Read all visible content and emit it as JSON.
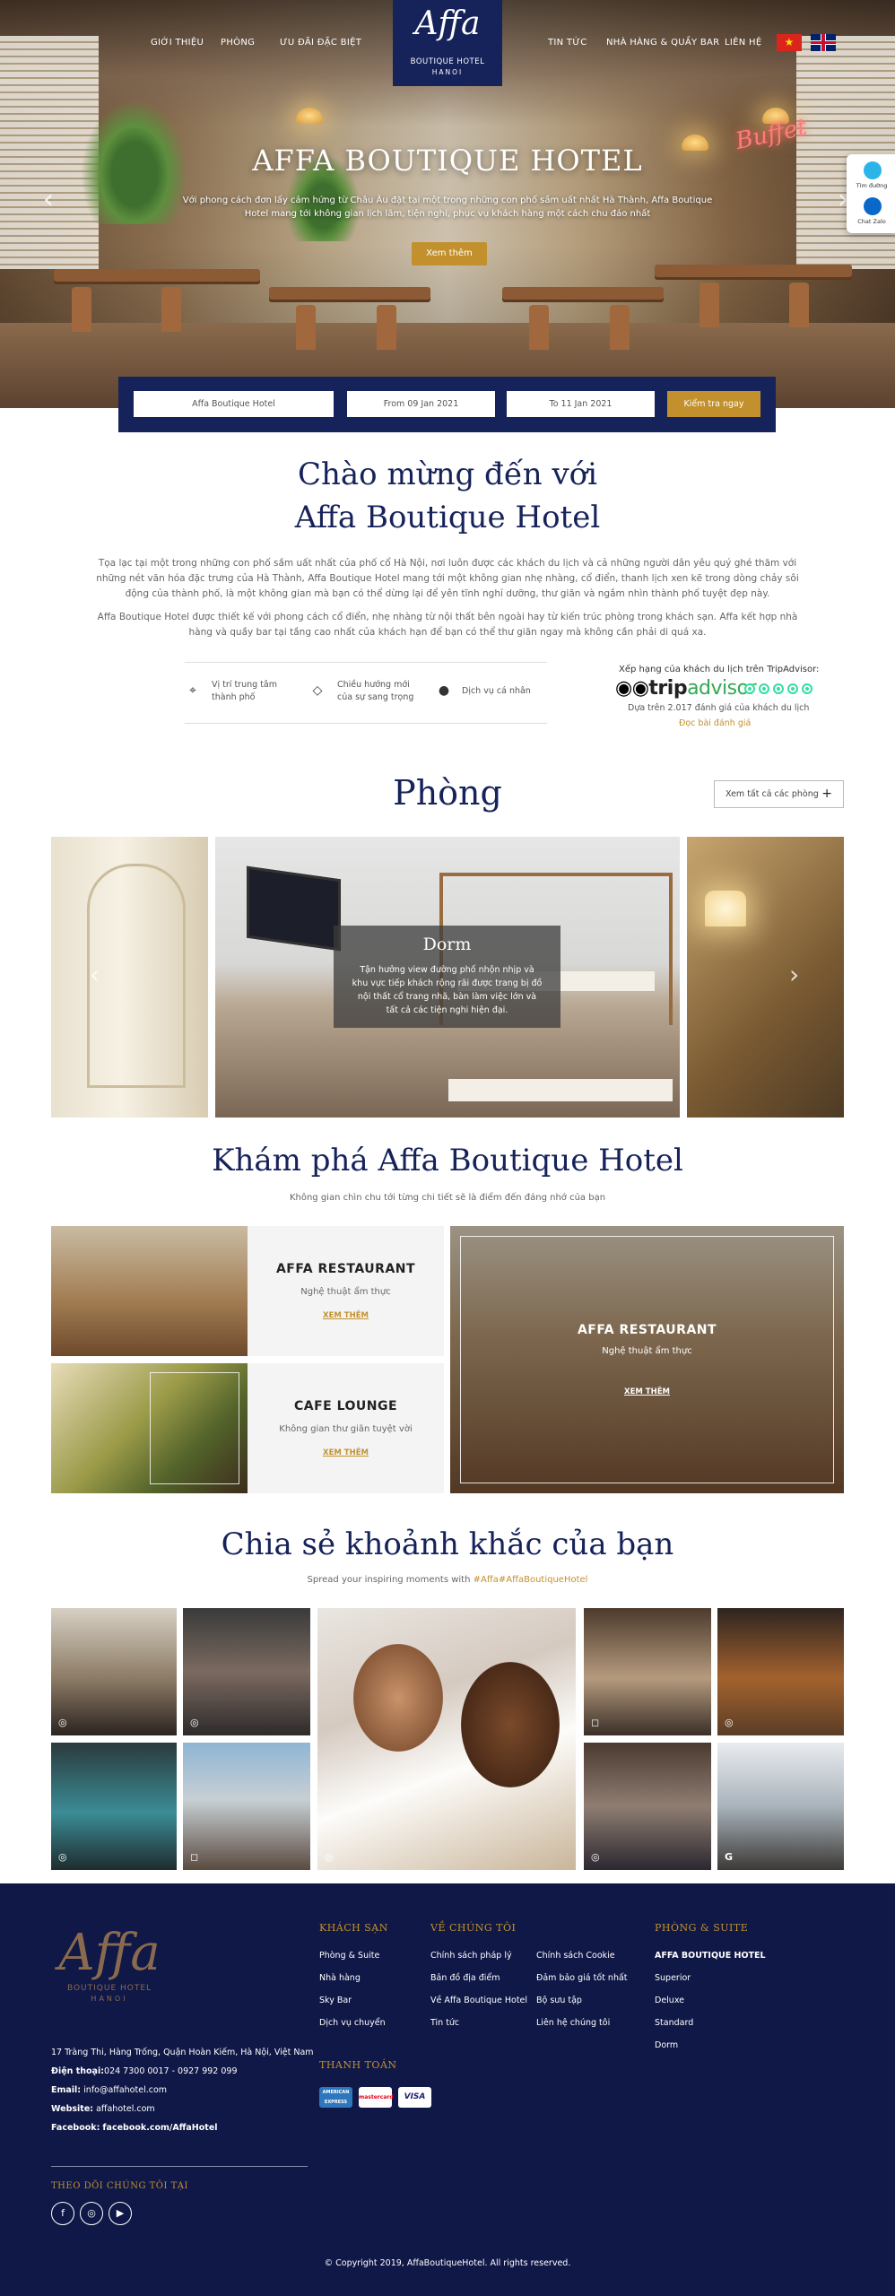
{
  "nav": {
    "left": [
      "GIỚI THIỆU",
      "PHÒNG",
      "ƯU ĐÃI ĐẶC BIỆT"
    ],
    "right": [
      "TIN TỨC",
      "NHÀ HÀNG & QUẦY BAR",
      "LIÊN HỆ"
    ]
  },
  "logo": {
    "mark": "Affa",
    "line1": "BOUTIQUE HOTEL",
    "line2": "HANOI"
  },
  "hero": {
    "title": "AFFA BOUTIQUE HOTEL",
    "subtitle": "Với phong cách đơn lấy cảm hứng từ Châu Âu đặt tại một trong những con phố sầm uất nhất Hà Thành, Affa Boutique Hotel mang tới không gian lịch lãm, tiện nghi, phục vụ khách hàng một cách chu đáo nhất",
    "button": "Xem thêm",
    "neon": "Buffet"
  },
  "side_widget": {
    "maps_label": "Tìm đường",
    "zalo_label": "Chat Zalo"
  },
  "booking": {
    "hotel": "Affa Boutique Hotel",
    "from": "From 09 Jan 2021",
    "to": "To 11 Jan 2021",
    "button": "Kiểm tra ngay"
  },
  "welcome": {
    "title_line1": "Chào mừng đến với",
    "title_line2": "Affa Boutique Hotel",
    "para1": "Tọa lạc tại một trong những con phố sầm uất nhất của phố cổ Hà Nội, nơi luôn được các khách du lịch và cả những người dân yêu quý ghé thăm với những nét văn hóa đặc trưng của Hà Thành, Affa Boutique Hotel mang tới một không gian nhẹ nhàng, cổ điển, thanh lịch xen kẽ trong dòng chảy sôi động của thành phố, là một không gian mà bạn có thể dừng lại để yên tĩnh nghỉ dưỡng, thư giãn và ngắm nhìn thành phố tuyệt đẹp này.",
    "para2": "Affa Boutique Hotel được thiết kế với phong cách cổ điển, nhẹ nhàng từ nội thất bên ngoài hay từ kiến trúc phòng trong khách sạn. Affa kết hợp nhà hàng và quầy bar tại tầng cao nhất của khách hạn để bạn có thể thư giãn ngay mà không cần phải di quá xa.",
    "features": [
      {
        "icon": "location-pin-icon",
        "line1": "Vị trí trung tâm",
        "line2": "thành phố"
      },
      {
        "icon": "diamond-icon",
        "line1": "Chiều hướng mới",
        "line2": "của sự sang trọng"
      },
      {
        "icon": "person-icon",
        "line1": "Dịch vụ cá nhân",
        "line2": ""
      }
    ],
    "tripadvisor": {
      "heading": "Xếp hạng của khách du lịch trên TripAdvisor:",
      "brand_trip": "trip",
      "brand_advisor": "advisor",
      "rating": 5,
      "reviews": "Dựa trên 2.017 đánh giá của khách du lịch",
      "read_link": "Đọc bài đánh giá"
    }
  },
  "rooms": {
    "title": "Phòng",
    "view_all": "Xem tất cả các phòng",
    "featured": {
      "name": "Dorm",
      "desc": "Tận hưởng view đường phố nhộn nhịp và khu vực tiếp khách rộng rãi được trang bị đồ nội thất cổ trang nhã, bàn làm việc lớn và tất cả các tiện nghi hiện đại."
    }
  },
  "explore": {
    "title": "Khám phá Affa Boutique Hotel",
    "subtitle": "Không gian chìn chu tới từng chi tiết sẽ là điểm đến đáng nhớ của bạn",
    "cards": [
      {
        "title": "AFFA RESTAURANT",
        "sub": "Nghệ thuật ẩm thực",
        "more": "XEM THÊM"
      },
      {
        "title": "CAFE LOUNGE",
        "sub": "Không gian thư giãn tuyệt vời",
        "more": "XEM THÊM"
      }
    ],
    "big": {
      "title": "AFFA RESTAURANT",
      "sub": "Nghệ thuật ẩm thực",
      "more": "XEM THÊM"
    }
  },
  "share": {
    "title": "Chia sẻ khoảnh khắc của bạn",
    "subtitle_prefix": "Spread your inspiring moments with ",
    "hashtag": "#Affa#AffaBoutiqueHotel"
  },
  "footer": {
    "logo": {
      "mark": "Affa",
      "line1": "BOUTIQUE HOTEL",
      "line2": "HANOI"
    },
    "address": "17 Tràng Thi, Hàng Trống, Quận Hoàn Kiếm, Hà Nội, Việt Nam",
    "phone_label": "Điện thoại:",
    "phone": "024 7300 0017 - 0927 992 099",
    "email_label": "Email:",
    "email": "info@affahotel.com",
    "website_label": "Website:",
    "website": "affahotel.com",
    "facebook_label": "Facebook:",
    "facebook": "facebook.com/AffaHotel",
    "follow": "THEO DÕI CHÚNG TÔI TẠI",
    "col1": {
      "heading": "KHÁCH SẠN",
      "links": [
        "Phòng & Suite",
        "Nhà hàng",
        "Sky Bar",
        "Dịch vụ chuyển"
      ]
    },
    "col2": {
      "heading": "VỀ CHÚNG TÔI",
      "links": [
        "Chính sách pháp lý",
        "Bản đồ địa điểm",
        "Về Affa Boutique Hotel",
        "Tin tức"
      ]
    },
    "col3": {
      "links": [
        "Chính sách Cookie",
        "Đảm bảo giá tốt nhất",
        "Bộ sưu tập",
        "Liên hệ chúng tôi"
      ]
    },
    "col4": {
      "heading": "PHÒNG & SUITE",
      "links": [
        "AFFA BOUTIQUE HOTEL",
        "Superior",
        "Deluxe",
        "Standard",
        "Dorm"
      ]
    },
    "payment": {
      "heading": "THANH TOÁN",
      "cards": [
        "AMERICAN EXPRESS",
        "mastercard",
        "VISA"
      ]
    },
    "copyright": "© Copyright 2019, AffaBoutiqueHotel. All rights reserved."
  },
  "colors": {
    "navy": "#16225a",
    "gold": "#c2912e",
    "footer_bg": "#0f1847",
    "tripadvisor_green": "#34e0a1"
  }
}
